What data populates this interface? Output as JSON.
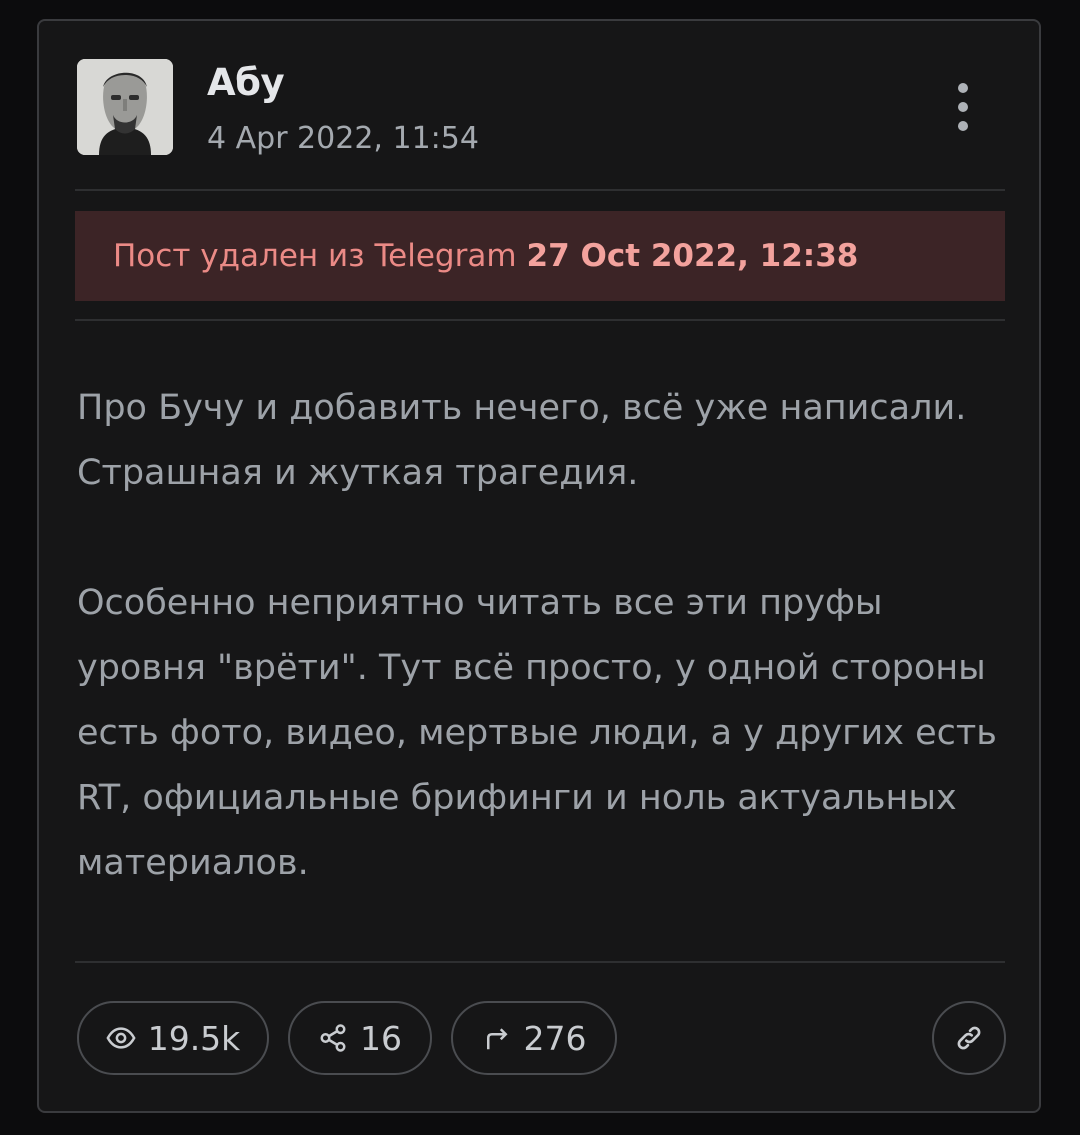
{
  "post": {
    "author": "Абу",
    "date": "4 Apr 2022, 11:54",
    "deleted_notice": {
      "text": "Пост удален из Telegram",
      "date": "27 Oct 2022, 12:38"
    },
    "paragraphs": [
      "Про Бучу и добавить нечего, всё уже написали. Страшная и жуткая трагедия.",
      "Особенно неприятно читать все эти пруфы уровня \"врёти\". Тут всё просто, у одной стороны есть фото, видео, мертвые люди, а у других есть RT, официальные брифинги и ноль актуальных материалов."
    ],
    "stats": {
      "views": "19.5k",
      "shares": "16",
      "forwards": "276"
    }
  },
  "icons": {
    "views": "eye-icon",
    "shares": "share-nodes-icon",
    "forwards": "forward-arrow-icon",
    "link": "link-icon",
    "menu": "more-vertical-icon"
  },
  "colors": {
    "background": "#0c0c0d",
    "card": "#161617",
    "banner_bg": "#3c2426",
    "banner_text": "#eb8a86"
  }
}
